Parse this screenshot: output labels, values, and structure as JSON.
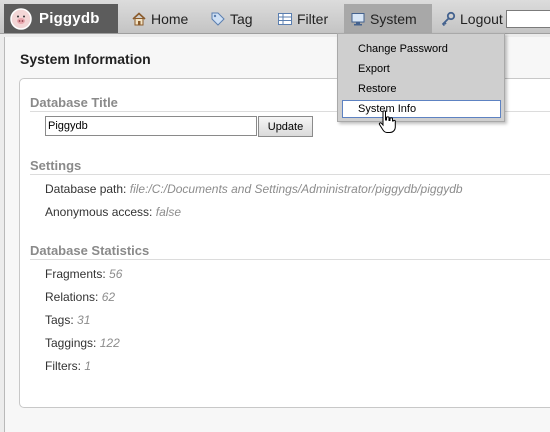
{
  "app": {
    "name": "Piggydb"
  },
  "nav": {
    "home": "Home",
    "tag": "Tag",
    "filter": "Filter",
    "system": "System",
    "logout": "Logout"
  },
  "search": {
    "value": ""
  },
  "system_menu": {
    "items": [
      "Change Password",
      "Export",
      "Restore",
      "System Info"
    ],
    "highlighted": "System Info"
  },
  "page": {
    "title": "System Information"
  },
  "database_title": {
    "heading": "Database Title",
    "value": "Piggydb",
    "button": "Update"
  },
  "settings": {
    "heading": "Settings",
    "rows": [
      {
        "label": "Database path:",
        "value": "file:/C:/Documents and Settings/Administrator/piggydb/piggydb"
      },
      {
        "label": "Anonymous access:",
        "value": "false"
      }
    ]
  },
  "statistics": {
    "heading": "Database Statistics",
    "rows": [
      {
        "label": "Fragments:",
        "value": "56"
      },
      {
        "label": "Relations:",
        "value": "62"
      },
      {
        "label": "Tags:",
        "value": "31"
      },
      {
        "label": "Taggings:",
        "value": "122"
      },
      {
        "label": "Filters:",
        "value": "1"
      }
    ]
  },
  "colors": {
    "logo_bg": "#5c5c5c",
    "active_nav": "#a8a8a8",
    "menu_bg": "#cfcfcf",
    "highlight_border": "#5d82c2",
    "value_text": "#8c8c8c"
  }
}
